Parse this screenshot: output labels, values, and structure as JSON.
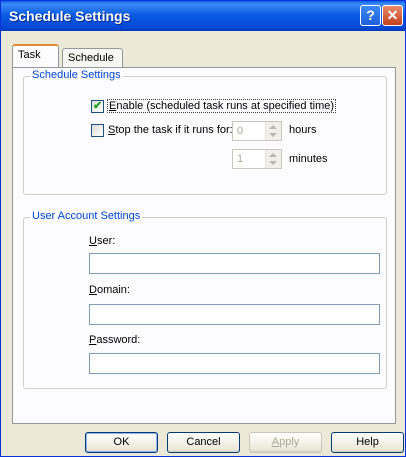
{
  "window": {
    "title": "Schedule Settings"
  },
  "titlebar": {
    "help_glyph": "?",
    "close_glyph": "✕"
  },
  "tabs": [
    {
      "label": "Task"
    },
    {
      "label": "Schedule"
    }
  ],
  "schedule_group": {
    "legend": "Schedule Settings",
    "enable_checked": true,
    "enable_key": "E",
    "enable_rest": "nable (scheduled task runs at specified time)",
    "stop_checked": false,
    "stop_key": "S",
    "stop_rest": "top the task if it runs for:",
    "hours_value": "0",
    "hours_label": "hours",
    "minutes_value": "1",
    "minutes_label": "minutes"
  },
  "account_group": {
    "legend": "User Account Settings",
    "user_key": "U",
    "user_rest": "ser:",
    "domain_key": "D",
    "domain_rest": "omain:",
    "password_key": "P",
    "password_rest": "assword:",
    "user_value": "",
    "domain_value": "",
    "password_value": ""
  },
  "buttons": {
    "ok": "OK",
    "cancel": "Cancel",
    "apply_key": "A",
    "apply_rest": "pply",
    "help": "Help"
  },
  "colors": {
    "accent": "#0046d5",
    "titlebar": "#0348d6",
    "check": "#21a121"
  },
  "icons": {
    "enable_checkbox": "checkmark-icon"
  }
}
